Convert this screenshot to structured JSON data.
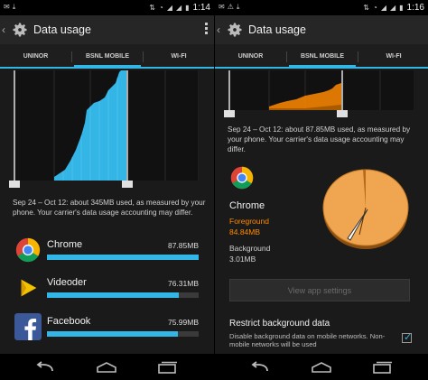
{
  "left": {
    "status_time": "1:14",
    "title": "Data usage",
    "tabs": [
      "UNINOR",
      "BSNL MOBILE",
      "WI-FI"
    ],
    "active_tab": "BSNL MOBILE",
    "summary": "Sep 24 – Oct 12: about 345MB used, as measured by your phone. Your carrier's data usage accounting may differ.",
    "apps": [
      {
        "name": "Chrome",
        "size": "87.85MB",
        "fraction": 1.0,
        "icon": "chrome-icon"
      },
      {
        "name": "Videoder",
        "size": "76.31MB",
        "fraction": 0.87,
        "icon": "videoder-icon"
      },
      {
        "name": "Facebook",
        "size": "75.99MB",
        "fraction": 0.86,
        "icon": "facebook-icon"
      }
    ]
  },
  "right": {
    "status_time": "1:16",
    "title": "Data usage",
    "tabs": [
      "UNINOR",
      "BSNL MOBILE",
      "WI-FI"
    ],
    "active_tab": "BSNL MOBILE",
    "summary": "Sep 24 – Oct 12: about 87.85MB used, as measured by your phone. Your carrier's data usage accounting may differ.",
    "app_name": "Chrome",
    "foreground_label": "Foreground",
    "foreground_value": "84.84MB",
    "background_label": "Background",
    "background_value": "3.01MB",
    "view_settings_label": "View app settings",
    "restrict_title": "Restrict background data",
    "restrict_desc": "Disable background data on mobile networks. Non-mobile networks will be used",
    "restrict_checked": true,
    "pie": {
      "foreground": 84.84,
      "background": 3.01
    }
  },
  "colors": {
    "accent": "#33b5e5",
    "foreground": "#ff8a00",
    "pie": "#f0a650"
  }
}
